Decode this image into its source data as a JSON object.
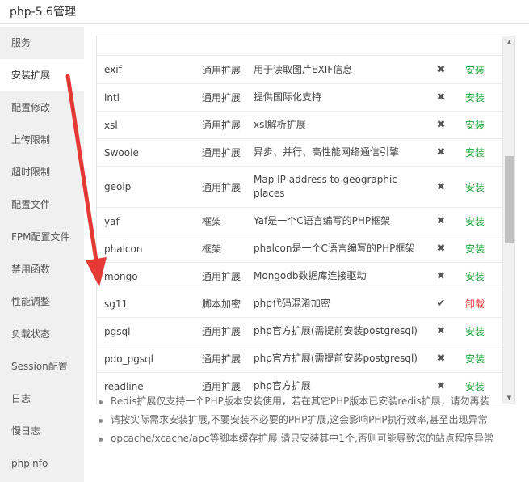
{
  "window": {
    "title": "php-5.6管理"
  },
  "sidebar": {
    "items": [
      {
        "label": "服务",
        "active": false
      },
      {
        "label": "安装扩展",
        "active": true
      },
      {
        "label": "配置修改",
        "active": false
      },
      {
        "label": "上传限制",
        "active": false
      },
      {
        "label": "超时限制",
        "active": false
      },
      {
        "label": "配置文件",
        "active": false
      },
      {
        "label": "FPM配置文件",
        "active": false
      },
      {
        "label": "禁用函数",
        "active": false
      },
      {
        "label": "性能调整",
        "active": false
      },
      {
        "label": "负载状态",
        "active": false
      },
      {
        "label": "Session配置",
        "active": false
      },
      {
        "label": "日志",
        "active": false
      },
      {
        "label": "慢日志",
        "active": false
      },
      {
        "label": "phpinfo",
        "active": false
      }
    ]
  },
  "extensions": [
    {
      "name": "",
      "type": "",
      "desc": "",
      "status": "",
      "action": ""
    },
    {
      "name": "exif",
      "type": "通用扩展",
      "desc": "用于读取图片EXIF信息",
      "status": "✖",
      "action": "安装"
    },
    {
      "name": "intl",
      "type": "通用扩展",
      "desc": "提供国际化支持",
      "status": "✖",
      "action": "安装"
    },
    {
      "name": "xsl",
      "type": "通用扩展",
      "desc": "xsl解析扩展",
      "status": "✖",
      "action": "安装"
    },
    {
      "name": "Swoole",
      "type": "通用扩展",
      "desc": "异步、并行、高性能网络通信引擎",
      "status": "✖",
      "action": "安装"
    },
    {
      "name": "geoip",
      "type": "通用扩展",
      "desc": "Map IP address to geographic places",
      "status": "✖",
      "action": "安装"
    },
    {
      "name": "yaf",
      "type": "框架",
      "desc": "Yaf是一个C语言编写的PHP框架",
      "status": "✖",
      "action": "安装"
    },
    {
      "name": "phalcon",
      "type": "框架",
      "desc": "phalcon是一个C语言编写的PHP框架",
      "status": "✖",
      "action": "安装"
    },
    {
      "name": "mongo",
      "type": "通用扩展",
      "desc": "Mongodb数据库连接驱动",
      "status": "✖",
      "action": "安装"
    },
    {
      "name": "sg11",
      "type": "脚本加密",
      "desc": "php代码混淆加密",
      "status": "✔",
      "action": "卸载"
    },
    {
      "name": "pgsql",
      "type": "通用扩展",
      "desc": "php官方扩展(需提前安装postgresql)",
      "status": "✖",
      "action": "安装"
    },
    {
      "name": "pdo_pgsql",
      "type": "通用扩展",
      "desc": "php官方扩展(需提前安装postgresql)",
      "status": "✖",
      "action": "安装"
    },
    {
      "name": "readline",
      "type": "通用扩展",
      "desc": "php官方扩展",
      "status": "✖",
      "action": "安装"
    }
  ],
  "notes": [
    "Redis扩展仅支持一个PHP版本安装使用，若在其它PHP版本已安装redis扩展，请勿再装",
    "请按实际需求安装扩展,不要安装不必要的PHP扩展,这会影响PHP执行效率,甚至出现异常",
    "opcache/xcache/apc等脚本缓存扩展,请只安装其中1个,否则可能导致您的站点程序异常"
  ],
  "colors": {
    "install": "#20a53a",
    "uninstall": "#e33333",
    "annotation_arrow": "#e53935"
  }
}
